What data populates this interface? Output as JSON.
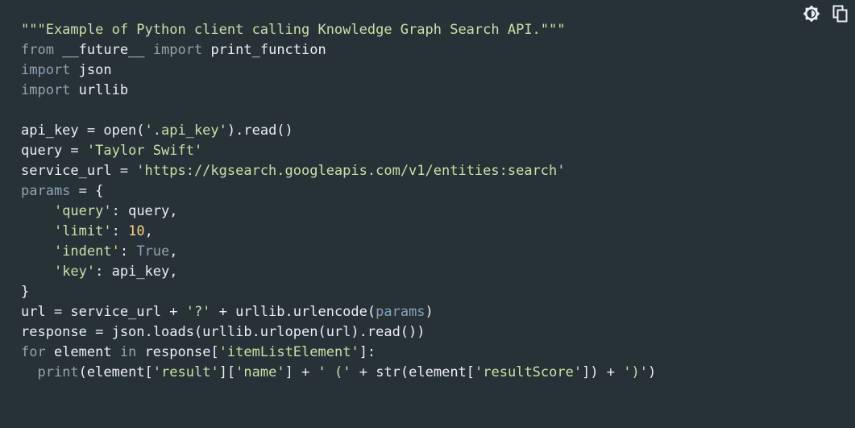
{
  "toolbar": {
    "theme_icon": "brightness-icon",
    "copy_icon": "copy-icon"
  },
  "colors": {
    "background": "#263238",
    "plain": "#eceff1",
    "keyword": "#8fa2af",
    "string": "#c5e1a5",
    "number": "#ffd180"
  },
  "code": {
    "language": "python",
    "lines": [
      [
        [
          "string",
          "\"\"\"Example of Python client calling Knowledge Graph Search API.\"\"\""
        ]
      ],
      [
        [
          "keyword",
          "from"
        ],
        [
          "plain",
          " __future__ "
        ],
        [
          "keyword",
          "import"
        ],
        [
          "plain",
          " print_function"
        ]
      ],
      [
        [
          "keyword",
          "import"
        ],
        [
          "plain",
          " json"
        ]
      ],
      [
        [
          "keyword",
          "import"
        ],
        [
          "plain",
          " urllib"
        ]
      ],
      [],
      [
        [
          "plain",
          "api_key = open("
        ],
        [
          "string",
          "'.api_key'"
        ],
        [
          "plain",
          ").read()"
        ]
      ],
      [
        [
          "plain",
          "query = "
        ],
        [
          "string",
          "'Taylor Swift'"
        ]
      ],
      [
        [
          "plain",
          "service_url = "
        ],
        [
          "string",
          "'https://kgsearch.googleapis.com/v1/entities:search'"
        ]
      ],
      [
        [
          "keyword",
          "params"
        ],
        [
          "plain",
          " = {"
        ]
      ],
      [
        [
          "plain",
          "    "
        ],
        [
          "string",
          "'query'"
        ],
        [
          "plain",
          ": query,"
        ]
      ],
      [
        [
          "plain",
          "    "
        ],
        [
          "string",
          "'limit'"
        ],
        [
          "plain",
          ": "
        ],
        [
          "number",
          "10"
        ],
        [
          "plain",
          ","
        ]
      ],
      [
        [
          "plain",
          "    "
        ],
        [
          "string",
          "'indent'"
        ],
        [
          "plain",
          ": "
        ],
        [
          "keyword",
          "True"
        ],
        [
          "plain",
          ","
        ]
      ],
      [
        [
          "plain",
          "    "
        ],
        [
          "string",
          "'key'"
        ],
        [
          "plain",
          ": api_key,"
        ]
      ],
      [
        [
          "plain",
          "}"
        ]
      ],
      [
        [
          "plain",
          "url = service_url + "
        ],
        [
          "string",
          "'?'"
        ],
        [
          "plain",
          " + urllib.urlencode("
        ],
        [
          "keyword",
          "params"
        ],
        [
          "plain",
          ")"
        ]
      ],
      [
        [
          "plain",
          "response = json.loads(urllib.urlopen(url).read())"
        ]
      ],
      [
        [
          "keyword",
          "for"
        ],
        [
          "plain",
          " element "
        ],
        [
          "keyword",
          "in"
        ],
        [
          "plain",
          " response["
        ],
        [
          "string",
          "'itemListElement'"
        ],
        [
          "plain",
          "]:"
        ]
      ],
      [
        [
          "plain",
          "  "
        ],
        [
          "keyword",
          "print"
        ],
        [
          "plain",
          "(element["
        ],
        [
          "string",
          "'result'"
        ],
        [
          "plain",
          "]["
        ],
        [
          "string",
          "'name'"
        ],
        [
          "plain",
          "] + "
        ],
        [
          "string",
          "' ('"
        ],
        [
          "plain",
          " + str(element["
        ],
        [
          "string",
          "'resultScore'"
        ],
        [
          "plain",
          "]) + "
        ],
        [
          "string",
          "')'"
        ],
        [
          "plain",
          ")"
        ]
      ]
    ]
  }
}
